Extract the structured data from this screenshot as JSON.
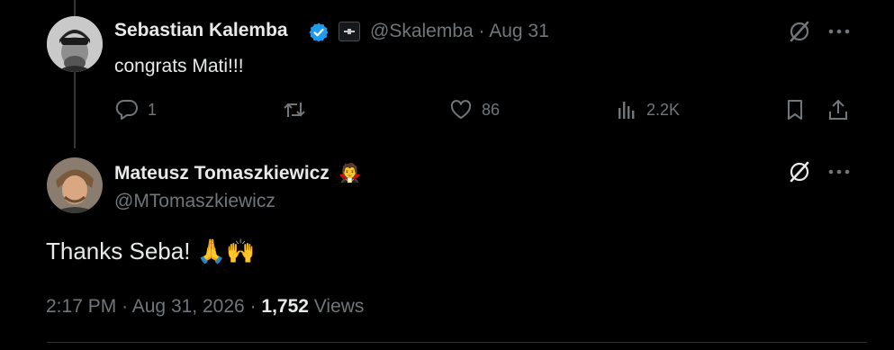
{
  "reply": {
    "author_name": "Sebastian Kalemba",
    "handle": "@Skalemba",
    "separator": "·",
    "date": "Aug 31",
    "text": "congrats Mati!!!",
    "actions": {
      "reply_count": "1",
      "repost_count": "",
      "like_count": "86",
      "views_count": "2.2K"
    }
  },
  "main": {
    "author_name": "Mateusz Tomaszkiewicz",
    "name_emoji": "🧛",
    "handle": "@MTomaszkiewicz",
    "text": "Thanks Seba! 🙏🙌",
    "meta": {
      "time": "2:17 PM",
      "sep1": "·",
      "date": "Aug 31, 2026",
      "sep2": "·",
      "views_number": "1,752",
      "views_label": "Views"
    }
  },
  "colors": {
    "background": "#000000",
    "text": "#e7e9ea",
    "muted": "#71767b",
    "verified": "#1d9bf0",
    "divider": "#2f3336"
  },
  "icons": [
    "verified-badge-icon",
    "affiliate-badge-icon",
    "grok-icon",
    "more-icon",
    "reply-icon",
    "repost-icon",
    "like-icon",
    "views-icon",
    "bookmark-icon",
    "share-icon"
  ]
}
